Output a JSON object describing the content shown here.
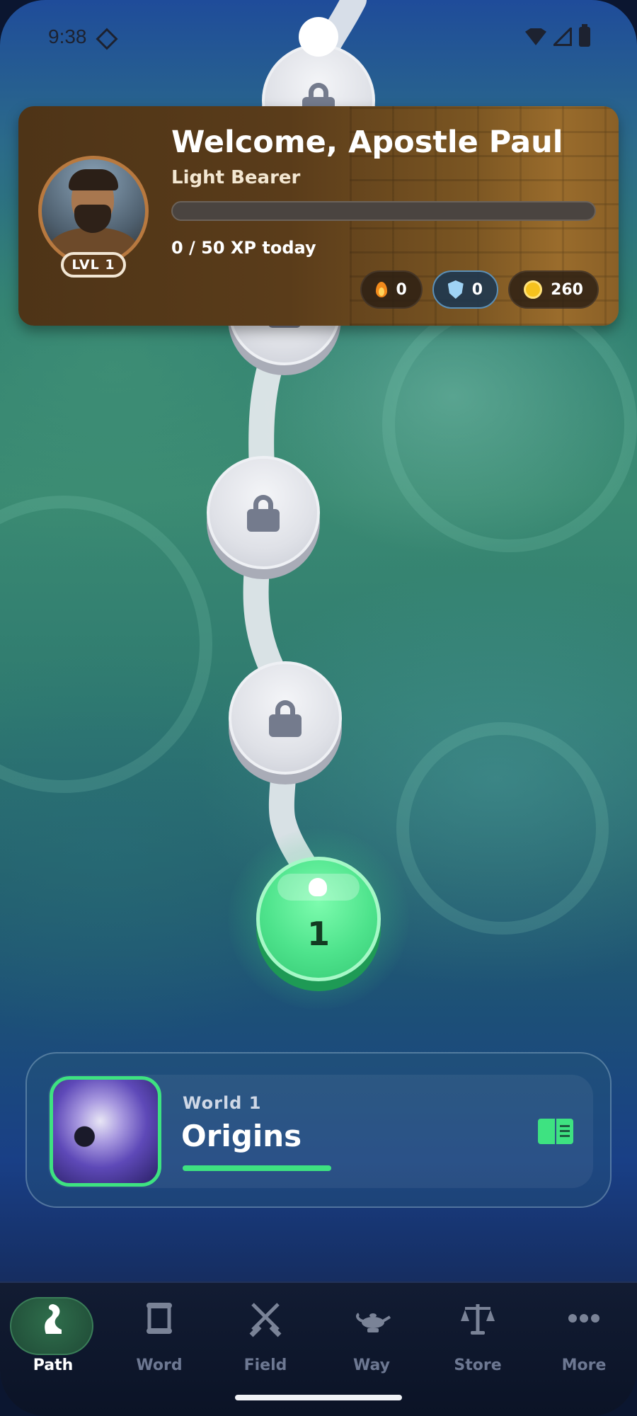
{
  "status_bar": {
    "time": "9:38"
  },
  "profile": {
    "welcome": "Welcome, Apostle Paul",
    "rank_title": "Light Bearer",
    "level_badge": "LVL 1",
    "xp_text": "0 / 50 XP today",
    "xp_progress": 0,
    "stats": {
      "streak": "0",
      "shield": "0",
      "coins": "260"
    }
  },
  "path": {
    "current_level": "1",
    "nodes": [
      {
        "state": "locked",
        "icon": "lock-icon"
      },
      {
        "state": "locked",
        "icon": "lock-icon"
      },
      {
        "state": "locked",
        "icon": "lock-icon"
      },
      {
        "state": "locked",
        "icon": "lock-icon"
      },
      {
        "state": "current",
        "label": "1"
      }
    ]
  },
  "world": {
    "label": "World 1",
    "name": "Origins",
    "progress": 1.0,
    "action_icon": "book-icon"
  },
  "bottom_nav": {
    "items": [
      {
        "label": "Path",
        "icon": "path-icon",
        "active": true
      },
      {
        "label": "Word",
        "icon": "scroll-icon",
        "active": false
      },
      {
        "label": "Field",
        "icon": "swords-icon",
        "active": false
      },
      {
        "label": "Way",
        "icon": "lamp-icon",
        "active": false
      },
      {
        "label": "Store",
        "icon": "scales-icon",
        "active": false
      },
      {
        "label": "More",
        "icon": "more-icon",
        "active": false
      }
    ]
  },
  "colors": {
    "accent_green": "#3ee281",
    "node_locked": "#dfe1e7",
    "card_brown": "#5a3c1a",
    "coin_gold": "#f5c21e"
  }
}
